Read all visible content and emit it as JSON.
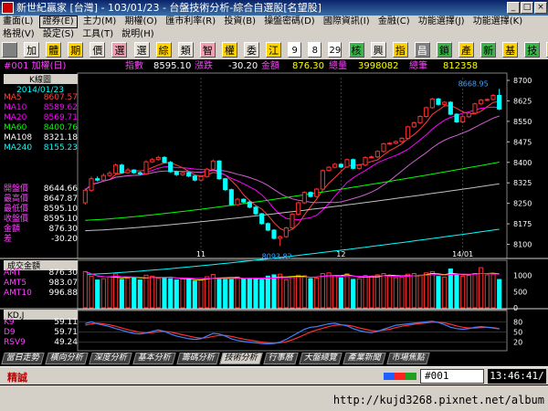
{
  "window": {
    "title": "新世紀贏家 [台灣] - 103/01/23 - 台盤技術分析-綜合自選股[名望股]",
    "buttons": [
      "_",
      "□",
      "×"
    ]
  },
  "menu1": [
    "畫面(L)",
    "證券(E)",
    "主力(M)",
    "期權(O)",
    "匯市利率(R)",
    "投資(B)",
    "操盤密碼(D)",
    "國際資訊(I)",
    "金融(C)",
    "功能選擇(J)",
    "功能選擇(K)"
  ],
  "menu2": [
    "格視(V)",
    "設定(S)",
    "工具(T)",
    "說明(H)"
  ],
  "toolbar": [
    "",
    "加",
    "體",
    "期",
    "價",
    "選",
    "選",
    "綜",
    "類",
    "智",
    "權",
    "委",
    "江",
    "9",
    "8",
    "29",
    "核",
    "興",
    "指",
    "昌",
    "鎖",
    "產",
    "新",
    "基",
    "技",
    "籌",
    "網"
  ],
  "info": {
    "code": "#001 加權(日)",
    "index_label": "指數",
    "index_value": "8595.10",
    "change_label": "漲跌",
    "change_value": "-30.20",
    "amount_label": "金額",
    "amount_value": "876.30",
    "volume_label": "總量",
    "volume_value": "3998082",
    "count_label": "總筆",
    "count_value": "812358"
  },
  "left_panel": {
    "k_label": "K線圖",
    "date": "2014/01/23",
    "ma": [
      {
        "name": "MA5",
        "value": "8607.57",
        "color": "#ff4040"
      },
      {
        "name": "MA10",
        "value": "8589.62",
        "color": "#ff00ff"
      },
      {
        "name": "MA20",
        "value": "8569.71",
        "color": "#ff00ff"
      },
      {
        "name": "MA60",
        "value": "8400.76",
        "color": "#00ff00"
      },
      {
        "name": "MA108",
        "value": "8321.18",
        "color": "#ffffff"
      },
      {
        "name": "MA240",
        "value": "8155.23",
        "color": "#00ffff"
      }
    ],
    "prices": [
      {
        "name": "開盤價",
        "value": "8644.66"
      },
      {
        "name": "最高價",
        "value": "8647.87"
      },
      {
        "name": "最低價",
        "value": "8595.10"
      },
      {
        "name": "收盤價",
        "value": "8595.10"
      },
      {
        "name": "金額",
        "value": "876.30"
      },
      {
        "name": "差",
        "value": "-30.20"
      }
    ]
  },
  "price_axis": [
    "8700",
    "8625",
    "8550",
    "8475",
    "8400",
    "8325",
    "8250",
    "8175",
    "8100"
  ],
  "price_annotations": {
    "high": "8668.95",
    "low": "8093.82"
  },
  "date_axis": [
    "11",
    "12",
    "14/01"
  ],
  "volume_panel": {
    "title": "成交金額",
    "rows": [
      {
        "name": "AMT",
        "value": "876.30"
      },
      {
        "name": "AMT5",
        "value": "983.07"
      },
      {
        "name": "AMT10",
        "value": "996.88"
      }
    ],
    "axis": [
      "1000",
      "500",
      "0"
    ]
  },
  "kd_panel": {
    "title": "KD,J",
    "rows": [
      {
        "name": "K9",
        "value": "59.11"
      },
      {
        "name": "D9",
        "value": "59.71"
      },
      {
        "name": "RSV9",
        "value": "49.24"
      }
    ],
    "axis": [
      "80",
      "50",
      "20"
    ]
  },
  "tabs": [
    {
      "label": "當日走勢",
      "active": false
    },
    {
      "label": "橫向分析",
      "active": false
    },
    {
      "label": "深度分析",
      "active": false
    },
    {
      "label": "基本分析",
      "active": false
    },
    {
      "label": "籌碼分析",
      "active": false
    },
    {
      "label": "技術分析",
      "active": true
    },
    {
      "label": "行事曆",
      "active": false
    },
    {
      "label": "大盤總覽",
      "active": false
    },
    {
      "label": "產業新聞",
      "active": false
    },
    {
      "label": "市場焦點",
      "active": false
    }
  ],
  "status": {
    "label": "精誠",
    "code": "#001",
    "time": "13:46:41/"
  },
  "footer_url": "http://kujd3268.pixnet.net/album",
  "colors": {
    "up": "#ff3030",
    "down": "#00ffff",
    "panel_bg": "#000000",
    "frame": "#d4d0c8"
  },
  "chart_data": {
    "type": "candlestick",
    "ylim": [
      8075,
      8710
    ],
    "open": [
      8252,
      8298,
      8340,
      8335,
      8352,
      8360,
      8390,
      8362,
      8372,
      8362,
      8358,
      8402,
      8410,
      8418,
      8400,
      8366,
      8355,
      8362,
      8350,
      8335,
      8348,
      8375,
      8405,
      8340,
      8300,
      8245,
      8265,
      8255,
      8236,
      8212,
      8176,
      8152,
      8122,
      8128,
      8160,
      8210,
      8252,
      8290,
      8275,
      8302,
      8370,
      8382,
      8393,
      8383,
      8410,
      8378,
      8390,
      8418,
      8420,
      8440,
      8468,
      8470,
      8476,
      8488,
      8530,
      8545,
      8568,
      8600,
      8632,
      8612,
      8620,
      8576,
      8548,
      8567,
      8580,
      8614,
      8628,
      8630,
      8645
    ],
    "close": [
      8298,
      8340,
      8335,
      8352,
      8360,
      8390,
      8362,
      8372,
      8362,
      8358,
      8402,
      8410,
      8418,
      8400,
      8366,
      8355,
      8362,
      8350,
      8335,
      8348,
      8375,
      8405,
      8340,
      8300,
      8245,
      8265,
      8255,
      8236,
      8212,
      8176,
      8152,
      8122,
      8128,
      8160,
      8210,
      8252,
      8290,
      8275,
      8302,
      8370,
      8382,
      8393,
      8383,
      8410,
      8378,
      8390,
      8418,
      8420,
      8440,
      8468,
      8470,
      8476,
      8488,
      8530,
      8545,
      8568,
      8600,
      8632,
      8612,
      8620,
      8576,
      8548,
      8567,
      8580,
      8614,
      8628,
      8630,
      8645,
      8595
    ],
    "high": [
      8305,
      8348,
      8348,
      8360,
      8368,
      8396,
      8395,
      8380,
      8375,
      8366,
      8408,
      8416,
      8424,
      8423,
      8405,
      8370,
      8368,
      8366,
      8352,
      8352,
      8380,
      8410,
      8408,
      8343,
      8304,
      8270,
      8268,
      8260,
      8240,
      8215,
      8180,
      8156,
      8132,
      8164,
      8214,
      8256,
      8294,
      8294,
      8306,
      8374,
      8386,
      8398,
      8396,
      8414,
      8414,
      8394,
      8422,
      8425,
      8444,
      8472,
      8474,
      8480,
      8492,
      8534,
      8549,
      8572,
      8604,
      8636,
      8636,
      8624,
      8624,
      8580,
      8571,
      8584,
      8618,
      8632,
      8634,
      8650,
      8669
    ],
    "low": [
      8245,
      8292,
      8330,
      8330,
      8348,
      8355,
      8358,
      8358,
      8358,
      8353,
      8354,
      8398,
      8406,
      8396,
      8362,
      8350,
      8350,
      8346,
      8330,
      8330,
      8344,
      8370,
      8336,
      8296,
      8241,
      8241,
      8251,
      8232,
      8208,
      8172,
      8148,
      8118,
      8094,
      8124,
      8156,
      8206,
      8248,
      8271,
      8271,
      8298,
      8366,
      8378,
      8379,
      8379,
      8374,
      8374,
      8386,
      8414,
      8416,
      8436,
      8464,
      8466,
      8472,
      8484,
      8526,
      8541,
      8564,
      8596,
      8608,
      8608,
      8572,
      8544,
      8544,
      8563,
      8576,
      8610,
      8624,
      8626,
      8591
    ],
    "ma_lines": [
      "MA5",
      "MA10",
      "MA20",
      "MA60",
      "MA108",
      "MA240"
    ],
    "volume": [
      1120,
      980,
      860,
      900,
      950,
      1050,
      880,
      920,
      940,
      860,
      1010,
      980,
      920,
      940,
      900,
      860,
      900,
      880,
      830,
      860,
      960,
      1030,
      920,
      880,
      890,
      950,
      900,
      910,
      880,
      860,
      980,
      1020,
      1040,
      870,
      940,
      1010,
      990,
      900,
      920,
      1060,
      1080,
      1000,
      930,
      1050,
      880,
      900,
      1000,
      980,
      1020,
      1060,
      980,
      930,
      940,
      1040,
      1060,
      1010,
      1080,
      1120,
      970,
      950,
      1200,
      1020,
      980,
      1000,
      1060,
      1240,
      1020,
      1040,
      876
    ],
    "k": [
      75,
      80,
      74,
      70,
      66,
      60,
      55,
      50,
      46,
      44,
      47,
      52,
      56,
      52,
      44,
      38,
      34,
      30,
      28,
      30,
      38,
      46,
      44,
      38,
      30,
      25,
      22,
      20,
      18,
      16,
      15,
      16,
      20,
      28,
      38,
      48,
      58,
      64,
      66,
      70,
      74,
      76,
      72,
      68,
      60,
      54,
      50,
      48,
      52,
      58,
      64,
      70,
      72,
      74,
      76,
      78,
      80,
      82,
      78,
      72,
      64,
      60,
      58,
      60,
      64,
      66,
      64,
      62,
      59
    ],
    "d": [
      70,
      74,
      76,
      74,
      71,
      67,
      62,
      57,
      53,
      49,
      47,
      48,
      51,
      52,
      50,
      46,
      42,
      38,
      34,
      32,
      33,
      37,
      40,
      40,
      37,
      33,
      29,
      26,
      23,
      20,
      18,
      17,
      18,
      21,
      27,
      34,
      42,
      50,
      56,
      61,
      66,
      70,
      71,
      70,
      67,
      62,
      58,
      54,
      53,
      55,
      58,
      63,
      67,
      70,
      73,
      75,
      77,
      79,
      79,
      77,
      73,
      68,
      64,
      62,
      62,
      63,
      64,
      63,
      60
    ]
  }
}
